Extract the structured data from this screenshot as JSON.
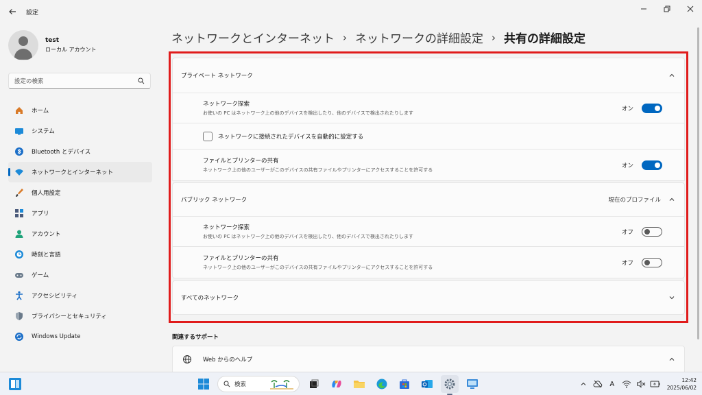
{
  "app": {
    "title": "設定"
  },
  "profile": {
    "name": "test",
    "account_type": "ローカル アカウント"
  },
  "search": {
    "placeholder": "設定の検索"
  },
  "nav": [
    {
      "label": "ホーム",
      "icon": "home-icon"
    },
    {
      "label": "システム",
      "icon": "system-icon"
    },
    {
      "label": "Bluetooth とデバイス",
      "icon": "bluetooth-icon"
    },
    {
      "label": "ネットワークとインターネット",
      "icon": "wifi-icon"
    },
    {
      "label": "個人用設定",
      "icon": "brush-icon"
    },
    {
      "label": "アプリ",
      "icon": "apps-icon"
    },
    {
      "label": "アカウント",
      "icon": "account-icon"
    },
    {
      "label": "時刻と言語",
      "icon": "clock-globe-icon"
    },
    {
      "label": "ゲーム",
      "icon": "gamepad-icon"
    },
    {
      "label": "アクセシビリティ",
      "icon": "accessibility-icon"
    },
    {
      "label": "プライバシーとセキュリティ",
      "icon": "shield-icon"
    },
    {
      "label": "Windows Update",
      "icon": "update-icon"
    }
  ],
  "breadcrumb": {
    "level1": "ネットワークとインターネット",
    "level2": "ネットワークの詳細設定",
    "current": "共有の詳細設定",
    "separator": "›"
  },
  "private": {
    "title": "プライベート ネットワーク",
    "discovery": {
      "title": "ネットワーク探索",
      "desc": "お使いの PC はネットワーク上の他のデバイスを検出したり、他のデバイスで検出されたりします",
      "state": "オン"
    },
    "auto_setup": {
      "label": "ネットワークに接続されたデバイスを自動的に設定する",
      "checked": false
    },
    "sharing": {
      "title": "ファイルとプリンターの共有",
      "desc": "ネットワーク上の他のユーザーがこのデバイスの共有ファイルやプリンターにアクセスすることを許可する",
      "state": "オン"
    }
  },
  "public": {
    "title": "パブリック ネットワーク",
    "badge": "現在のプロファイル",
    "discovery": {
      "title": "ネットワーク探索",
      "desc": "お使いの PC はネットワーク上の他のデバイスを検出したり、他のデバイスで検出されたりします",
      "state": "オフ"
    },
    "sharing": {
      "title": "ファイルとプリンターの共有",
      "desc": "ネットワーク上の他のユーザーがこのデバイスの共有ファイルやプリンターにアクセスすることを許可する",
      "state": "オフ"
    }
  },
  "all_networks": {
    "title": "すべてのネットワーク"
  },
  "related": {
    "title": "関連するサポート",
    "web_help": "Web からのヘルプ"
  },
  "taskbar": {
    "search_placeholder": "検索",
    "input_indicator": "A",
    "time": "12:42",
    "date": "2025/06/02"
  },
  "colors": {
    "accent": "#0067c0",
    "highlight_border": "#e01b1b"
  }
}
